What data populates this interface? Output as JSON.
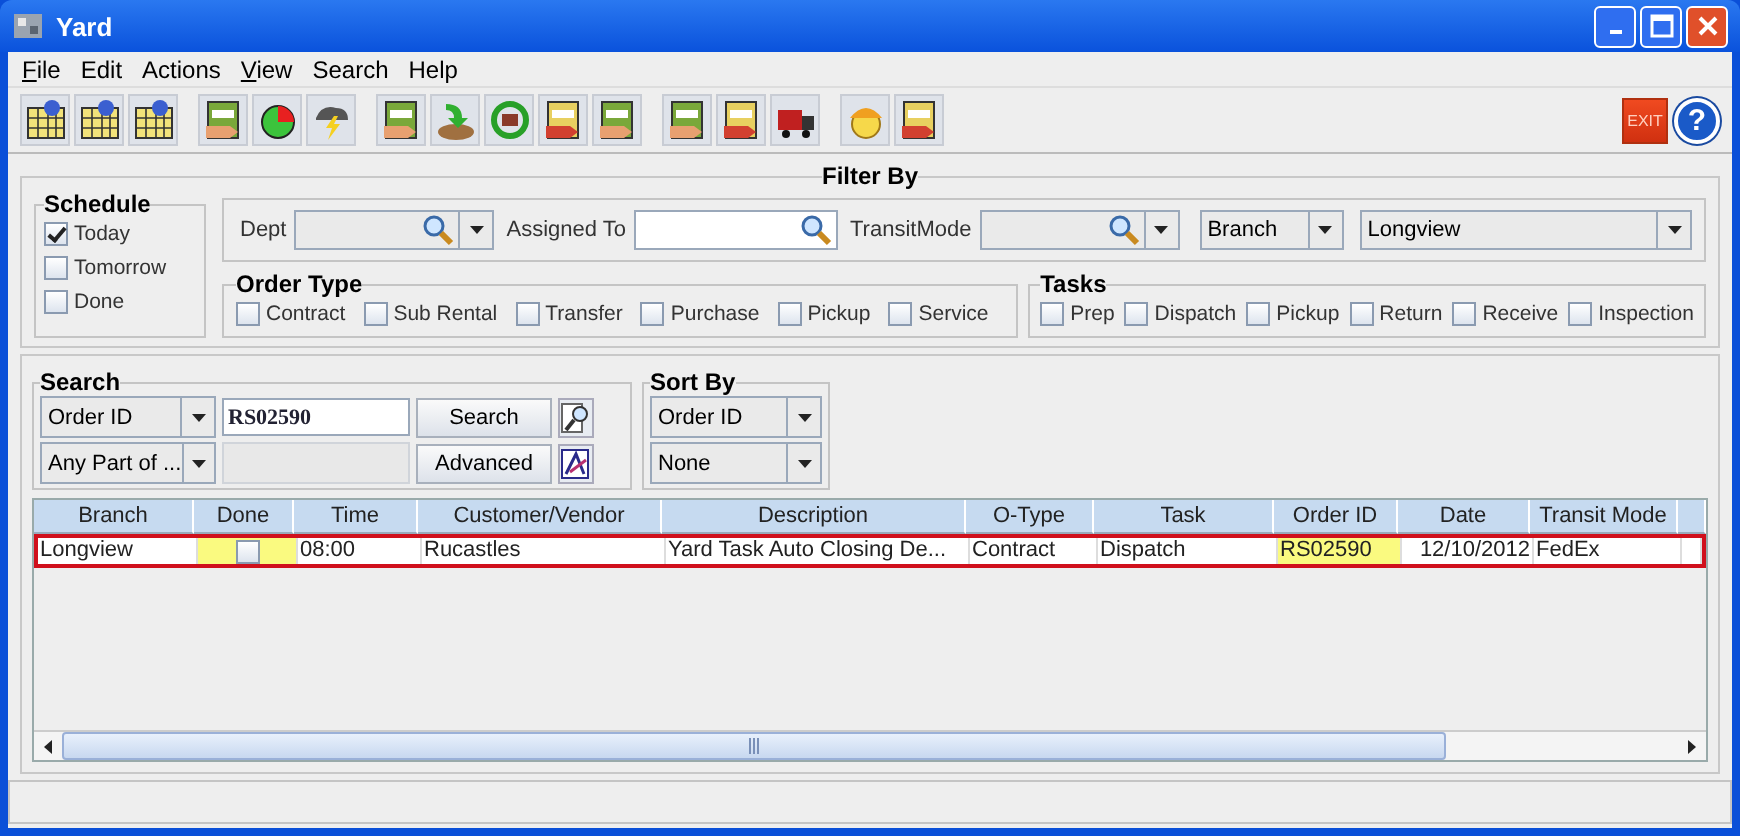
{
  "window": {
    "title": "Yard"
  },
  "menu": [
    {
      "label": "File",
      "underlined": true
    },
    {
      "label": "Edit",
      "underlined": false
    },
    {
      "label": "Actions",
      "underlined": false
    },
    {
      "label": "View",
      "underlined": true
    },
    {
      "label": "Search",
      "underlined": false
    },
    {
      "label": "Help",
      "underlined": false
    }
  ],
  "toolbar": {
    "exit_label": "EXIT",
    "help_label": "?"
  },
  "filter": {
    "title": "Filter By",
    "schedule": {
      "title": "Schedule",
      "options": [
        {
          "label": "Today",
          "checked": true
        },
        {
          "label": "Tomorrow",
          "checked": false
        },
        {
          "label": "Done",
          "checked": false
        }
      ]
    },
    "dept": {
      "label": "Dept"
    },
    "assigned_to": {
      "label": "Assigned To"
    },
    "transit_mode": {
      "label": "TransitMode"
    },
    "location_type": {
      "value": "Branch"
    },
    "location": {
      "value": "Longview"
    },
    "order_type": {
      "title": "Order Type",
      "options": [
        {
          "label": "Contract",
          "checked": false
        },
        {
          "label": "Sub Rental",
          "checked": false
        },
        {
          "label": "Transfer",
          "checked": false
        },
        {
          "label": "Purchase",
          "checked": false
        },
        {
          "label": "Pickup",
          "checked": false
        },
        {
          "label": "Service",
          "checked": false
        }
      ]
    },
    "tasks": {
      "title": "Tasks",
      "options": [
        {
          "label": "Prep",
          "checked": false
        },
        {
          "label": "Dispatch",
          "checked": false
        },
        {
          "label": "Pickup",
          "checked": false
        },
        {
          "label": "Return",
          "checked": false
        },
        {
          "label": "Receive",
          "checked": false
        },
        {
          "label": "Inspection",
          "checked": false
        }
      ]
    }
  },
  "search": {
    "title": "Search",
    "field": {
      "value": "Order ID"
    },
    "match": {
      "value": "Any Part of ..."
    },
    "query": {
      "value": "RS02590"
    },
    "buttons": [
      "Search",
      "Advanced"
    ]
  },
  "sort": {
    "title": "Sort By",
    "primary": {
      "value": "Order ID"
    },
    "secondary": {
      "value": "None"
    }
  },
  "table": {
    "columns": [
      "Branch",
      "Done",
      "Time",
      "Customer/Vendor",
      "Description",
      "O-Type",
      "Task",
      "Order ID",
      "Date",
      "Transit Mode"
    ],
    "rows": [
      {
        "selected": true,
        "cells": [
          {
            "kind": "text",
            "text": "Longview",
            "highlighted": false
          },
          {
            "kind": "check",
            "checked": false,
            "highlighted": true
          },
          {
            "kind": "text",
            "text": "08:00",
            "highlighted": false
          },
          {
            "kind": "text",
            "text": "Rucastles",
            "highlighted": false
          },
          {
            "kind": "text",
            "text": "Yard Task Auto Closing De...",
            "highlighted": false
          },
          {
            "kind": "text",
            "text": "Contract",
            "highlighted": false
          },
          {
            "kind": "text",
            "text": "Dispatch",
            "highlighted": false
          },
          {
            "kind": "text",
            "text": "RS02590",
            "highlighted": true
          },
          {
            "kind": "date",
            "text": "12/10/2012",
            "highlighted": false
          },
          {
            "kind": "text",
            "text": "FedEx",
            "highlighted": false
          }
        ]
      }
    ]
  }
}
